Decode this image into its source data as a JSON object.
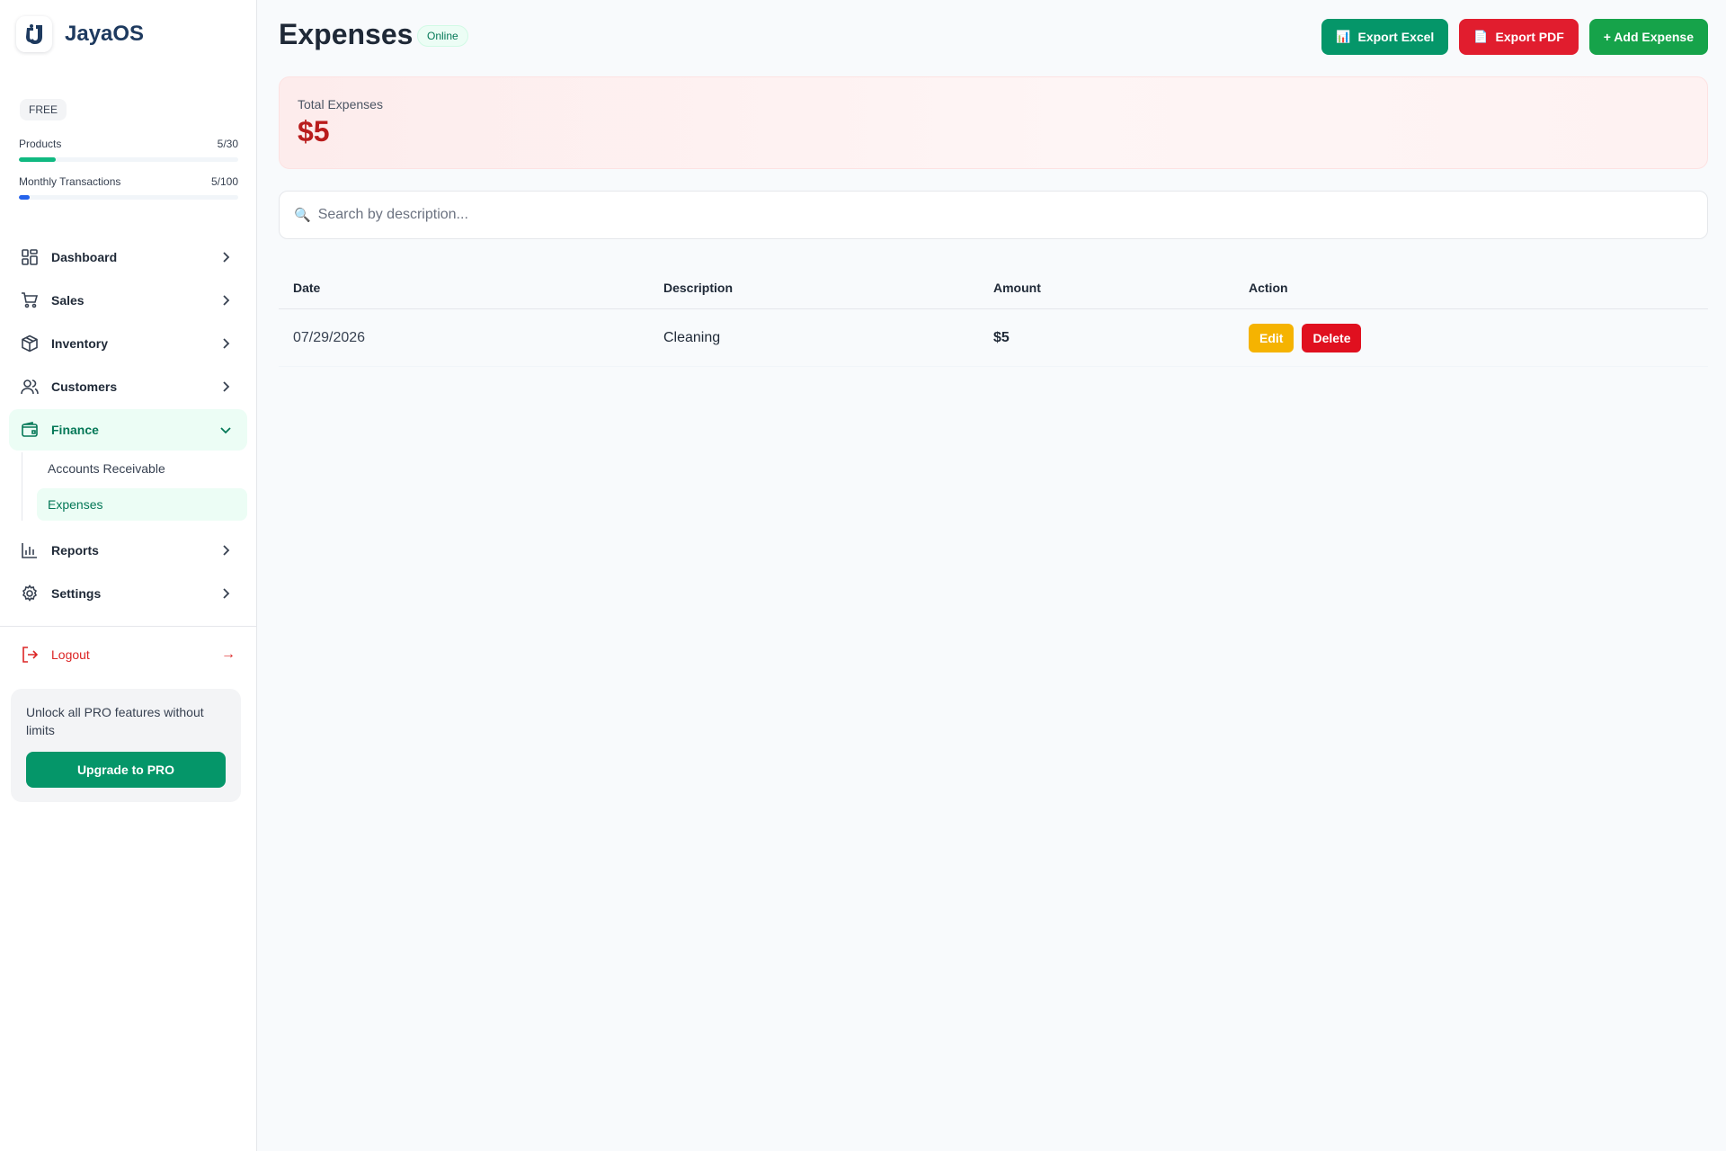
{
  "brand": {
    "name": "JayaOS",
    "logo_icon": "jayaos-logo-icon"
  },
  "plan": {
    "badge": "FREE",
    "usage": [
      {
        "label": "Products",
        "value": "5/30",
        "fraction": 0.167,
        "color": "#10b981"
      },
      {
        "label": "Monthly Transactions",
        "value": "5/100",
        "fraction": 0.05,
        "color": "#2563eb"
      }
    ]
  },
  "sidebar": {
    "items": [
      {
        "label": "Dashboard",
        "icon": "dashboard-grid-icon"
      },
      {
        "label": "Sales",
        "icon": "shopping-cart-icon"
      },
      {
        "label": "Inventory",
        "icon": "package-box-icon"
      },
      {
        "label": "Customers",
        "icon": "users-icon"
      },
      {
        "label": "Finance",
        "icon": "wallet-icon",
        "expanded": true,
        "children": [
          {
            "label": "Accounts Receivable"
          },
          {
            "label": "Expenses",
            "active": true
          }
        ]
      },
      {
        "label": "Reports",
        "icon": "bar-chart-icon"
      },
      {
        "label": "Settings",
        "icon": "gear-icon"
      }
    ],
    "logout": {
      "label": "Logout",
      "arrow": "→"
    },
    "promo": {
      "text": "Unlock all PRO features without limits",
      "button": "Upgrade to PRO"
    }
  },
  "header": {
    "title": "Expenses",
    "status": "Online",
    "buttons": {
      "export_excel": {
        "icon": "📊",
        "label": "Export Excel"
      },
      "export_pdf": {
        "icon": "📄",
        "label": "Export PDF"
      },
      "add_expense": "+ Add Expense"
    }
  },
  "summary": {
    "label": "Total Expenses",
    "value": "$5"
  },
  "search": {
    "icon": "🔍",
    "placeholder": "Search by description...",
    "value": ""
  },
  "table": {
    "columns": [
      "Date",
      "Description",
      "Amount",
      "Action"
    ],
    "rows": [
      {
        "date": "07/29/2026",
        "description": "Cleaning",
        "amount": "$5",
        "edit": "Edit",
        "delete": "Delete"
      }
    ]
  },
  "colors": {
    "accent": "#059669",
    "danger": "#e11d2e",
    "warning": "#f5b301",
    "total": "#b91c1c"
  }
}
